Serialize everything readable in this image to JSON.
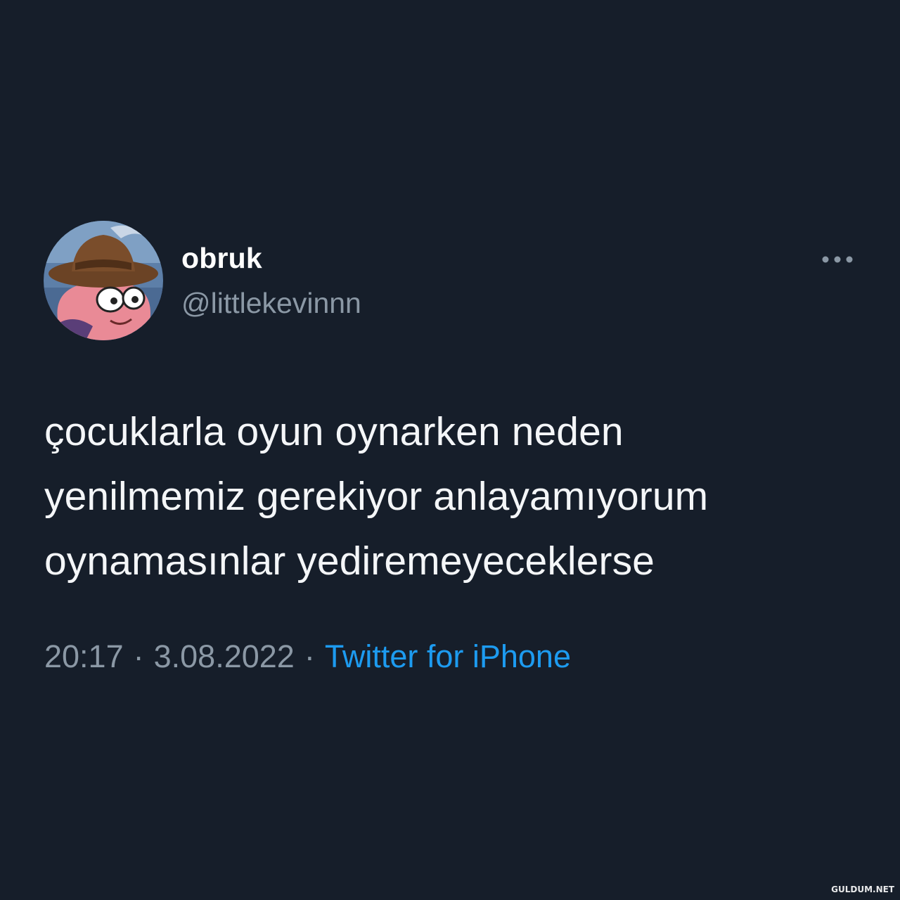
{
  "tweet": {
    "display_name": "obruk",
    "handle": "@littlekevinnn",
    "text": "çocuklarla oyun oynarken neden\nyenilmemiz gerekiyor anlayamıyorum\noynamasınlar yedireme­yeceklerse",
    "time": "20:17",
    "date": "3.08.2022",
    "separator": "·",
    "source": "Twitter for iPhone"
  },
  "icons": {
    "avatar": "cartoon-cowboy-avatar",
    "more": "more-horizontal-icon"
  },
  "colors": {
    "background": "#161e2a",
    "text": "#f4f6f8",
    "secondary": "#8b98a5",
    "link": "#1d9bf0"
  },
  "watermark": "GULDUM.NET"
}
